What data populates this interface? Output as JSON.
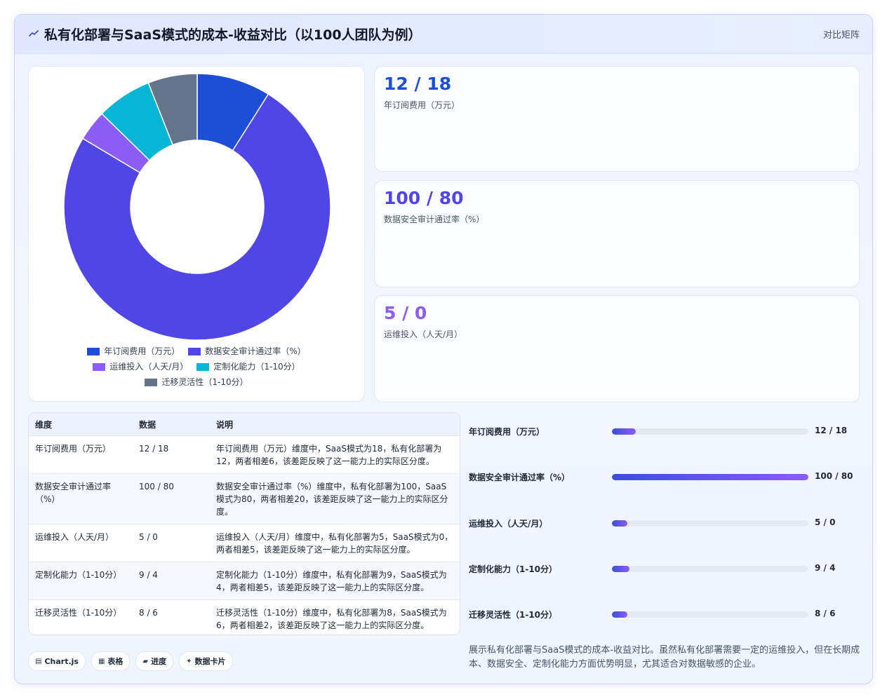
{
  "header": {
    "title": "私有化部署与SaaS模式的成本-收益对比（以100人团队为例）",
    "tag": "对比矩阵"
  },
  "stats": [
    {
      "value": "12 / 18",
      "label": "年订阅费用（万元）",
      "color": "#1d4ed8"
    },
    {
      "value": "100 / 80",
      "label": "数据安全审计通过率（%）",
      "color": "#4f46e5"
    },
    {
      "value": "5 / 0",
      "label": "运维投入（人天/月）",
      "color": "#8b5cf6"
    }
  ],
  "table": {
    "headers": [
      "维度",
      "数据",
      "说明"
    ],
    "rows": [
      {
        "dim": "年订阅费用（万元）",
        "data": "12 / 18",
        "desc": "年订阅费用（万元）维度中，SaaS模式为18，私有化部署为12，两者相差6，该差距反映了这一能力上的实际区分度。"
      },
      {
        "dim": "数据安全审计通过率（%）",
        "data": "100 / 80",
        "desc": "数据安全审计通过率（%）维度中，私有化部署为100，SaaS模式为80，两者相差20，该差距反映了这一能力上的实际区分度。"
      },
      {
        "dim": "运维投入（人天/月）",
        "data": "5 / 0",
        "desc": "运维投入（人天/月）维度中，私有化部署为5，SaaS模式为0，两者相差5，该差距反映了这一能力上的实际区分度。"
      },
      {
        "dim": "定制化能力（1-10分）",
        "data": "9 / 4",
        "desc": "定制化能力（1-10分）维度中，私有化部署为9，SaaS模式为4，两者相差5，该差距反映了这一能力上的实际区分度。"
      },
      {
        "dim": "迁移灵活性（1-10分）",
        "data": "8 / 6",
        "desc": "迁移灵活性（1-10分）维度中，私有化部署为8，SaaS模式为6，两者相差2，该差距反映了这一能力上的实际区分度。"
      }
    ]
  },
  "progress": [
    {
      "label": "年订阅费用（万元）",
      "value": "12 / 18",
      "fraction": 0.12
    },
    {
      "label": "数据安全审计通过率（%）",
      "value": "100 / 80",
      "fraction": 1.0
    },
    {
      "label": "运维投入（人天/月）",
      "value": "5 / 0",
      "fraction": 0.08
    },
    {
      "label": "定制化能力（1-10分）",
      "value": "9 / 4",
      "fraction": 0.09
    },
    {
      "label": "迁移灵活性（1-10分）",
      "value": "8 / 6",
      "fraction": 0.08
    }
  ],
  "chips": [
    {
      "icon": "▤",
      "label": "Chart.js"
    },
    {
      "icon": "▦",
      "label": "表格"
    },
    {
      "icon": "▰",
      "label": "进度"
    },
    {
      "icon": "✦",
      "label": "数据卡片"
    }
  ],
  "note": "展示私有化部署与SaaS模式的成本-收益对比。虽然私有化部署需要一定的运维投入，但在长期成本、数据安全、定制化能力方面优势明显，尤其适合对数据敏感的企业。",
  "chart_data": {
    "type": "pie",
    "donut": true,
    "categories": [
      "年订阅费用（万元）",
      "数据安全审计通过率（%）",
      "运维投入（人天/月）",
      "定制化能力（1-10分）",
      "迁移灵活性（1-10分）"
    ],
    "values": [
      12,
      100,
      5,
      9,
      8
    ],
    "colors": [
      "#1d4ed8",
      "#4f46e5",
      "#8b5cf6",
      "#06b6d4",
      "#64748b"
    ],
    "legend": "bottom"
  }
}
